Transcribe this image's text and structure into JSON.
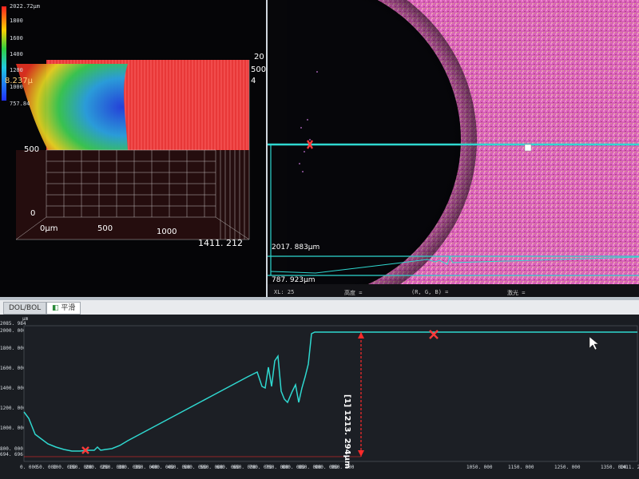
{
  "colors": {
    "profile_line": "#2fd8d0",
    "marker": "#ff3a3a",
    "measure": "#ff2a2a",
    "cursor": "#ffffff"
  },
  "view3d": {
    "colorbar": {
      "max": "2022.72μm",
      "t1": "1800",
      "t2": "1600",
      "t3": "1400",
      "t4": "1200",
      "t5": "1000",
      "min": "757.84",
      "overlay": "8.237μ"
    },
    "axis_z_top": "20",
    "axis_z_mid": "500",
    "axis_z_low": "4",
    "axis_y_500": "500",
    "axis_y_0": "0",
    "axis_x_0": "0μm",
    "axis_x_500": "500",
    "axis_x_1000": "1000",
    "extent": "1411. 212"
  },
  "micro": {
    "label_upper": "2017. 883μm",
    "label_lower": "787. 923μm",
    "status": [
      "XL: 25",
      "高度 =",
      "(R, G, B) =",
      "激光 ="
    ]
  },
  "tabs": [
    "DOL/BOL",
    "平滑"
  ],
  "profile": {
    "y_unit": "μm",
    "y_top": "2085. 984",
    "y_ticks": [
      "2000. 000",
      "1800. 000",
      "1600. 000",
      "1400. 000",
      "1200. 000",
      "1000. 000",
      "800. 000"
    ],
    "y_bottom": "694. 696",
    "x_ticks": [
      "0. 000",
      "50. 000",
      "100. 000",
      "150. 000",
      "200. 000",
      "250. 000",
      "300. 000",
      "350. 000",
      "400. 000",
      "450. 000",
      "500. 000",
      "550. 000",
      "600. 000",
      "650. 000",
      "700. 000",
      "750. 000",
      "800. 000",
      "850. 000",
      "900. 000",
      "950. 000",
      "1050. 000",
      "1150. 000",
      "1250. 000",
      "1350. 000",
      "1411. 212"
    ],
    "measure_label": "[1] 1213. 294μm"
  }
}
